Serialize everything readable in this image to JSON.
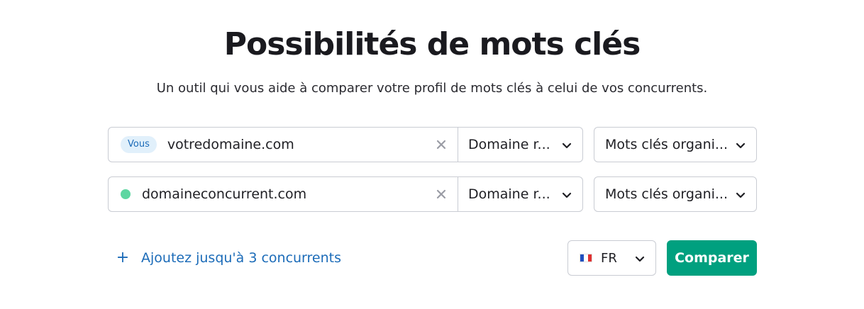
{
  "header": {
    "title": "Possibilités de mots clés",
    "subtitle": "Un outil qui vous aide à comparer votre profil de mots clés à celui de vos concurrents."
  },
  "rows": [
    {
      "badge": "Vous",
      "domain": "votredomaine.com",
      "clear_icon": "close-icon",
      "scope": "Domaine r...",
      "keyword_type": "Mots clés organi..."
    },
    {
      "indicator_color": "#5ed6a1",
      "domain": "domaineconcurrent.com",
      "clear_icon": "close-icon",
      "scope": "Domaine r...",
      "keyword_type": "Mots clés organi..."
    }
  ],
  "footer": {
    "add_competitors": "Ajoutez jusqu'à 3 concurrents",
    "plus_icon": "plus-icon",
    "language": "FR",
    "flag_icon": "france-flag-icon",
    "compare": "Comparer"
  },
  "colors": {
    "accent": "#00a07f",
    "link": "#1b6bb8",
    "badge_bg": "#e1f0fb"
  }
}
